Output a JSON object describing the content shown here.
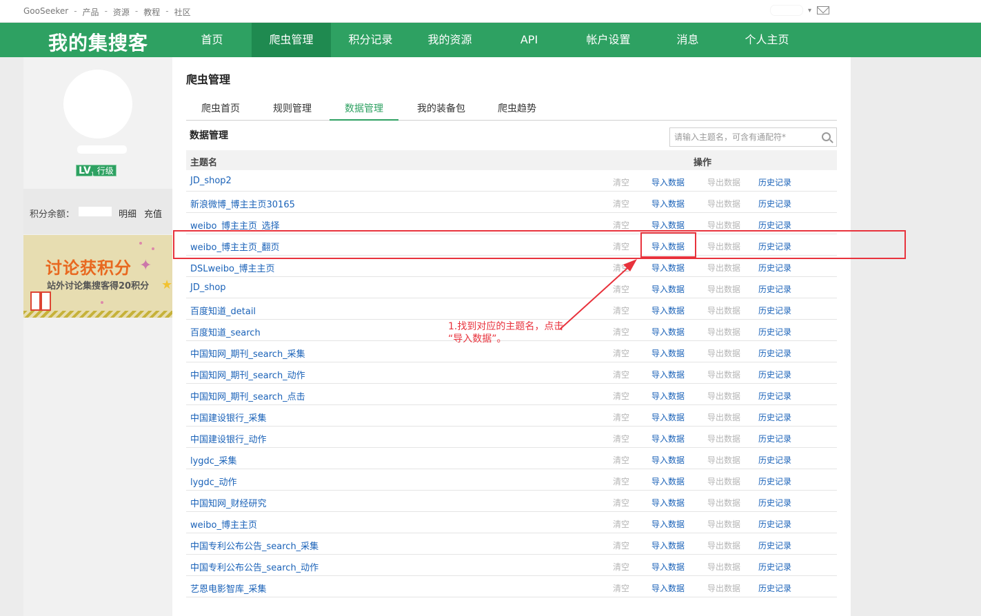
{
  "topbar": {
    "links": [
      "GooSeeker",
      "产品",
      "资源",
      "教程",
      "社区"
    ]
  },
  "nav": {
    "brand": "我的集搜客",
    "items": [
      "首页",
      "爬虫管理",
      "积分记录",
      "我的资源",
      "API",
      "帐户设置",
      "消息",
      "个人主页"
    ],
    "active_index": 1
  },
  "sidebar": {
    "level_prefix": "LV",
    "level_num": "1",
    "level_text": "行级",
    "points_label": "积分余额：",
    "detail_link": "明细",
    "recharge_link": "充值",
    "banner_title": "讨论获积分",
    "banner_sub": "站外讨论集搜客得20积分"
  },
  "main": {
    "title": "爬虫管理",
    "tabs": [
      "爬虫首页",
      "规则管理",
      "数据管理",
      "我的装备包",
      "爬虫趋势"
    ],
    "active_tab": 2,
    "section_title": "数据管理",
    "search_placeholder": "请输入主题名，可含有通配符*",
    "col_name": "主题名",
    "col_ops": "操作",
    "ops": {
      "clear": "清空",
      "import": "导入数据",
      "export": "导出数据",
      "history": "历史记录"
    },
    "rows": [
      "JD_shop2",
      "新浪微博_博主主页30165",
      "weibo_博主主页_选择",
      "weibo_博主主页_翻页",
      "DSLweibo_博主主页",
      "JD_shop",
      "百度知道_detail",
      "百度知道_search",
      "中国知网_期刊_search_采集",
      "中国知网_期刊_search_动作",
      "中国知网_期刊_search_点击",
      "中国建设银行_采集",
      "中国建设银行_动作",
      "lygdc_采集",
      "lygdc_动作",
      "中国知网_财经研究",
      "weibo_博主主页",
      "中国专利公布公告_search_采集",
      "中国专利公布公告_search_动作",
      "艺恩电影智库_采集"
    ]
  },
  "annotation": {
    "note_line1": "1.找到对应的主题名，点击",
    "note_line2": "“导入数据”。",
    "color": "#e8323c"
  }
}
